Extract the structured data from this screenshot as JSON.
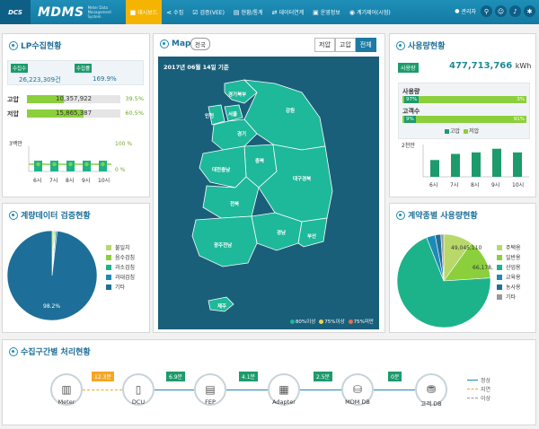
{
  "header": {
    "logo_dcs": "DCS",
    "logo_mdms": "MDMS",
    "logo_sub": "Meter Data Management System",
    "nav": [
      {
        "label": "대시보드",
        "icon": "dashboard-icon"
      },
      {
        "label": "수집",
        "icon": "share-icon"
      },
      {
        "label": "검증(VEE)",
        "icon": "check-icon"
      },
      {
        "label": "현황/통계",
        "icon": "chart-icon"
      },
      {
        "label": "데이터연계",
        "icon": "link-icon"
      },
      {
        "label": "운영정보",
        "icon": "document-icon"
      },
      {
        "label": "계기제어(시험)",
        "icon": "meter-icon"
      }
    ],
    "user": "관리자"
  },
  "lp": {
    "title": "LP수집현황",
    "collect_label": "수집수",
    "collect_value": "26,223,309건",
    "rate_label": "수집률",
    "rate_value": "169.9%",
    "high_label": "고압",
    "high_value": "10,357,922",
    "high_pct": "39.5%",
    "high_fill": 39.5,
    "low_label": "저압",
    "low_value": "15,865,387",
    "low_pct": "60.5%",
    "low_fill": 60.5,
    "chart": {
      "y_left_top": "3백만",
      "y_right_top": "100 %",
      "y_right_bottom": "0 %",
      "categories": [
        "6시",
        "7시",
        "8시",
        "9시",
        "10시"
      ]
    }
  },
  "map": {
    "title": "Map",
    "badge": "전국",
    "segments": [
      "저압",
      "고압",
      "전체"
    ],
    "active_segment": 2,
    "date": "2017년 06월 14일 기준",
    "regions": [
      "경기북부",
      "인천",
      "서울",
      "강원",
      "경기",
      "충북",
      "대전충남",
      "대구경북",
      "전북",
      "경남",
      "부산",
      "광주전남",
      "제주"
    ],
    "legend": [
      "80%이상",
      "75%이상",
      "75%미만"
    ],
    "colors": {
      "high": "#1eb89a",
      "mid": "#f2d34a",
      "low": "#e8704a"
    }
  },
  "usage": {
    "title": "사용량현황",
    "total_label": "사용량",
    "total_value": "477,713,766",
    "unit": "kWh",
    "usage_label": "사용량",
    "usage_left": "97%",
    "usage_right": "3%",
    "customer_label": "고객수",
    "customer_left": "9%",
    "customer_right": "91%",
    "legend_high": "고압",
    "legend_low": "저압",
    "chart": {
      "y_top": "2천만",
      "categories": [
        "6시",
        "7시",
        "8시",
        "9시",
        "10시"
      ],
      "values": [
        0.55,
        0.75,
        0.8,
        0.92,
        0.8
      ]
    }
  },
  "verify": {
    "title": "계량데이터 검증현황",
    "pie_label": "98.2%",
    "legend": [
      {
        "label": "불일치",
        "color": "#b8d96a"
      },
      {
        "label": "음수검침",
        "color": "#8ccf3c"
      },
      {
        "label": "과소검침",
        "color": "#1db38a"
      },
      {
        "label": "과대검침",
        "color": "#1d8ab8"
      },
      {
        "label": "기타",
        "color": "#1d6f99"
      }
    ],
    "values": [
      0.6,
      0.4,
      0.3,
      0.5,
      98.2
    ]
  },
  "contract": {
    "title": "계약종별 사용량현황",
    "label1": "49,045,110",
    "label2": "66,178,",
    "legend": [
      {
        "label": "주택용",
        "color": "#b8d96a"
      },
      {
        "label": "일반용",
        "color": "#8ccf3c"
      },
      {
        "label": "산업용",
        "color": "#1db38a"
      },
      {
        "label": "교육용",
        "color": "#1d8ab8"
      },
      {
        "label": "농사용",
        "color": "#1d6f99"
      },
      {
        "label": "기타",
        "color": "#999999"
      }
    ],
    "values": [
      10,
      14,
      70,
      3,
      2,
      1
    ]
  },
  "flow": {
    "title": "수집구간별 처리현황",
    "nodes": [
      "Meter",
      "DCU",
      "FEP",
      "Adapter",
      "MDM DB",
      "고객 DB"
    ],
    "badges": [
      "12.3분",
      "6.9분",
      "4.1분",
      "2.5분",
      "0분"
    ],
    "legend": [
      "정상",
      "지연",
      "이상"
    ]
  }
}
